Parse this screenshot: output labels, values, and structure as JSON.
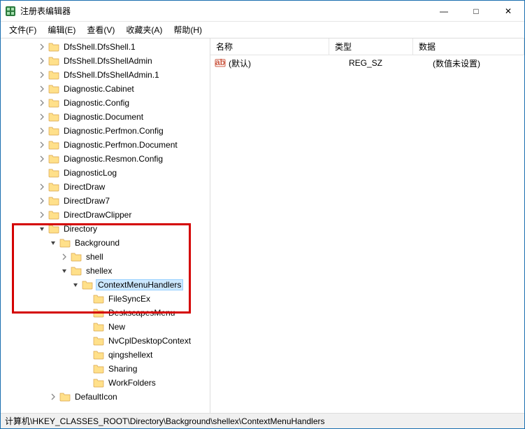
{
  "window": {
    "title": "注册表编辑器",
    "minimize": "—",
    "maximize": "□",
    "close": "✕"
  },
  "menu": {
    "file": "文件(F)",
    "edit": "编辑(E)",
    "view": "查看(V)",
    "favorites": "收藏夹(A)",
    "help": "帮助(H)"
  },
  "columns": {
    "name": "名称",
    "type": "类型",
    "data": "数据"
  },
  "values": [
    {
      "name": "(默认)",
      "type": "REG_SZ",
      "data": "(数值未设置)"
    }
  ],
  "statusbar": "计算机\\HKEY_CLASSES_ROOT\\Directory\\Background\\shellex\\ContextMenuHandlers",
  "tree": [
    {
      "indent": 3,
      "expander": ">",
      "label": "DfsShell.DfsShell.1"
    },
    {
      "indent": 3,
      "expander": ">",
      "label": "DfsShell.DfsShellAdmin"
    },
    {
      "indent": 3,
      "expander": ">",
      "label": "DfsShell.DfsShellAdmin.1"
    },
    {
      "indent": 3,
      "expander": ">",
      "label": "Diagnostic.Cabinet"
    },
    {
      "indent": 3,
      "expander": ">",
      "label": "Diagnostic.Config"
    },
    {
      "indent": 3,
      "expander": ">",
      "label": "Diagnostic.Document"
    },
    {
      "indent": 3,
      "expander": ">",
      "label": "Diagnostic.Perfmon.Config"
    },
    {
      "indent": 3,
      "expander": ">",
      "label": "Diagnostic.Perfmon.Document"
    },
    {
      "indent": 3,
      "expander": ">",
      "label": "Diagnostic.Resmon.Config"
    },
    {
      "indent": 3,
      "expander": "",
      "label": "DiagnosticLog"
    },
    {
      "indent": 3,
      "expander": ">",
      "label": "DirectDraw"
    },
    {
      "indent": 3,
      "expander": ">",
      "label": "DirectDraw7"
    },
    {
      "indent": 3,
      "expander": ">",
      "label": "DirectDrawClipper"
    },
    {
      "indent": 3,
      "expander": "v",
      "label": "Directory"
    },
    {
      "indent": 4,
      "expander": "v",
      "label": "Background"
    },
    {
      "indent": 5,
      "expander": ">",
      "label": "shell"
    },
    {
      "indent": 5,
      "expander": "v",
      "label": "shellex"
    },
    {
      "indent": 6,
      "expander": "v",
      "label": "ContextMenuHandlers",
      "selected": true
    },
    {
      "indent": 7,
      "expander": "",
      "label": "FileSyncEx"
    },
    {
      "indent": 7,
      "expander": "",
      "label": "DeskscapesMenu"
    },
    {
      "indent": 7,
      "expander": "",
      "label": "New"
    },
    {
      "indent": 7,
      "expander": "",
      "label": "NvCplDesktopContext"
    },
    {
      "indent": 7,
      "expander": "",
      "label": "qingshellext"
    },
    {
      "indent": 7,
      "expander": "",
      "label": "Sharing"
    },
    {
      "indent": 7,
      "expander": "",
      "label": "WorkFolders"
    },
    {
      "indent": 4,
      "expander": ">",
      "label": "DefaultIcon"
    }
  ]
}
